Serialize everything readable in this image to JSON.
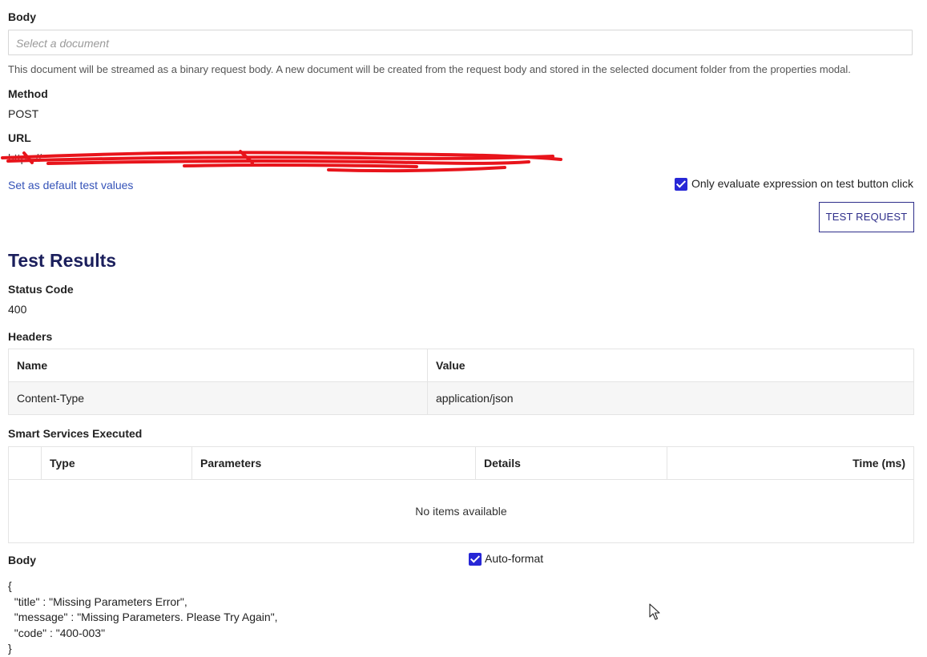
{
  "body_section": {
    "label": "Body",
    "placeholder": "Select a document",
    "help_text": "This document will be streamed as a binary request body. A new document will be created from the request body and stored in the selected document folder from the properties modal."
  },
  "method": {
    "label": "Method",
    "value": "POST"
  },
  "url": {
    "label": "URL",
    "value": "https://"
  },
  "actions": {
    "default_link": "Set as default test values",
    "only_eval_label": "Only evaluate expression on test button click",
    "only_eval_checked": true,
    "test_button": "TEST REQUEST"
  },
  "results": {
    "title": "Test Results",
    "status_code_label": "Status Code",
    "status_code": "400",
    "headers_label": "Headers",
    "headers_columns": [
      "Name",
      "Value"
    ],
    "headers_rows": [
      {
        "name": "Content-Type",
        "value": "application/json"
      }
    ],
    "smart_services_label": "Smart Services Executed",
    "smart_services_columns": [
      "",
      "Type",
      "Parameters",
      "Details",
      "Time (ms)"
    ],
    "smart_services_empty": "No items available",
    "body_label": "Body",
    "auto_format_label": "Auto-format",
    "auto_format_checked": true,
    "body_json": "{\n  \"title\" : \"Missing Parameters Error\",\n  \"message\" : \"Missing Parameters. Please Try Again\",\n  \"code\" : \"400-003\"\n}"
  },
  "colors": {
    "accent": "#2727d6",
    "title": "#1b1f5c",
    "link": "#3553b8",
    "redaction": "#e8141b"
  }
}
